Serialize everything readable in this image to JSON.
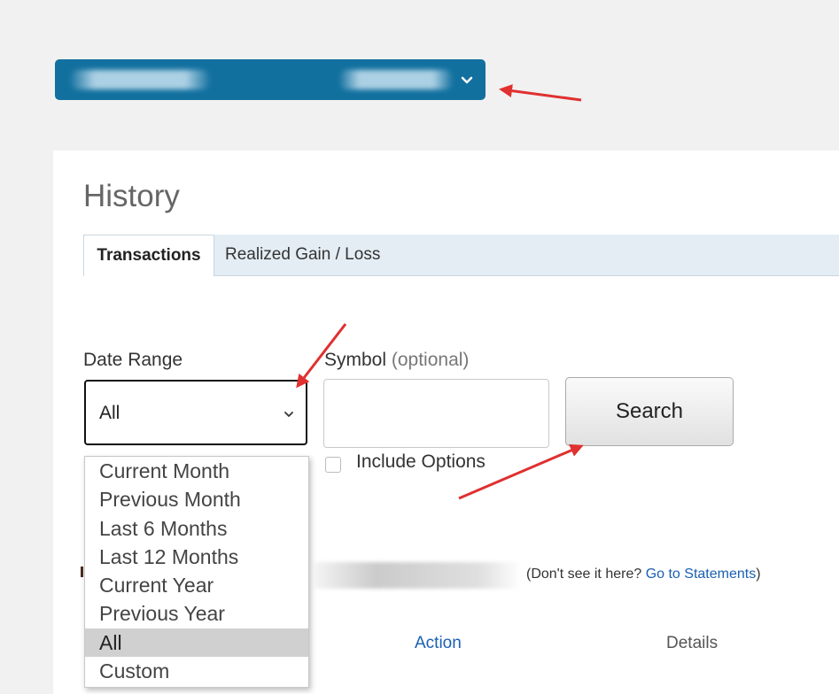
{
  "account_selector": {
    "chevron_icon": "chevron-down-icon"
  },
  "history": {
    "title": "History",
    "tabs": [
      {
        "label": "Transactions",
        "active": true
      },
      {
        "label": "Realized Gain / Loss",
        "active": false
      }
    ]
  },
  "filters": {
    "date_range": {
      "label": "Date Range",
      "selected": "All",
      "options": [
        "Current Month",
        "Previous Month",
        "Last 6 Months",
        "Last 12 Months",
        "Current Year",
        "Previous Year",
        "All",
        "Custom"
      ]
    },
    "symbol": {
      "label": "Symbol",
      "optional": "(optional)",
      "value": ""
    },
    "include_options": {
      "label": "Include Options",
      "checked": false
    },
    "search_button": "Search"
  },
  "statements_note": {
    "prefix": "(Don't see it here?",
    "link": "Go to Statements",
    "suffix": ")"
  },
  "table": {
    "columns": [
      "Action",
      "Details"
    ]
  },
  "colors": {
    "accent": "#12709f",
    "link": "#1a5fb4",
    "annotation_arrow": "#e03030"
  }
}
